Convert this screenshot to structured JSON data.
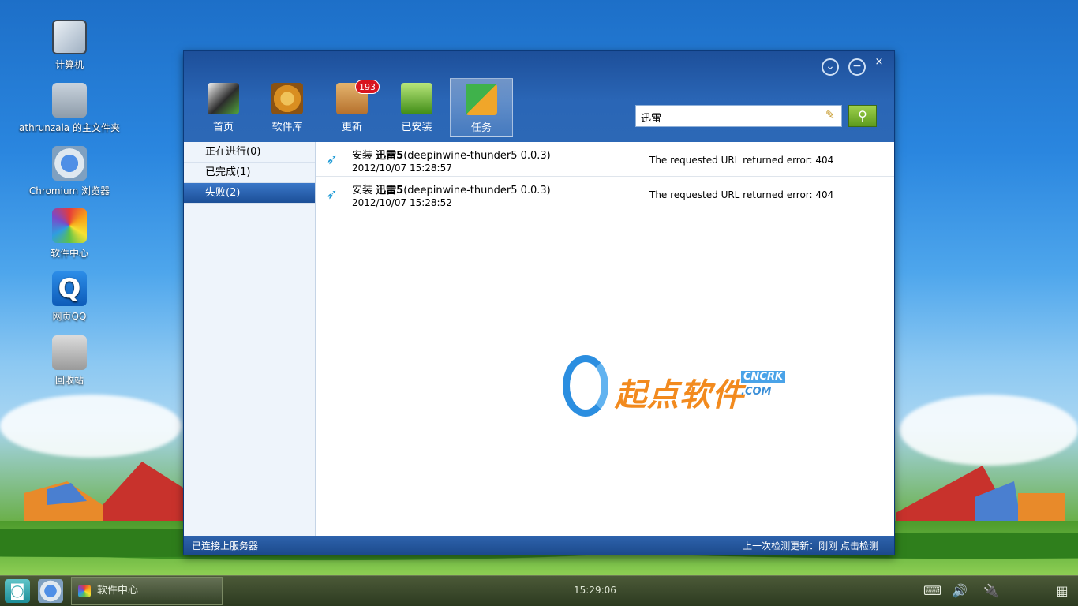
{
  "desktop": {
    "icons": [
      {
        "label": "计算机"
      },
      {
        "label": "athrunzala 的主文件夹"
      },
      {
        "label": "Chromium 浏览器"
      },
      {
        "label": "软件中心"
      },
      {
        "label": "网页QQ"
      },
      {
        "label": "回收站"
      }
    ]
  },
  "window": {
    "controls": {
      "close": "×"
    },
    "nav": [
      {
        "label": "首页"
      },
      {
        "label": "软件库"
      },
      {
        "label": "更新",
        "badge": "193"
      },
      {
        "label": "已安装"
      },
      {
        "label": "任务"
      }
    ],
    "search": {
      "value": "迅雷"
    },
    "sidebar": [
      {
        "label": "正在进行(0)"
      },
      {
        "label": "已完成(1)"
      },
      {
        "label": "失败(2)"
      }
    ],
    "tasks": [
      {
        "prefix": "安装 ",
        "name": "迅雷5",
        "package": "(deepinwine-thunder5 0.0.3)",
        "time": "2012/10/07 15:28:57",
        "error": "The requested URL returned error: 404"
      },
      {
        "prefix": "安装 ",
        "name": "迅雷5",
        "package": "(deepinwine-thunder5 0.0.3)",
        "time": "2012/10/07 15:28:52",
        "error": "The requested URL returned error: 404"
      }
    ],
    "watermark": {
      "cn": "起点软件",
      "en1": "CNCRK",
      "en2": ".COM"
    },
    "statusbar": {
      "left": "已连接上服务器",
      "right": "上一次检测更新：刚刚   点击检测"
    }
  },
  "taskbar": {
    "app_label": "软件中心",
    "clock": "15:29:06"
  }
}
